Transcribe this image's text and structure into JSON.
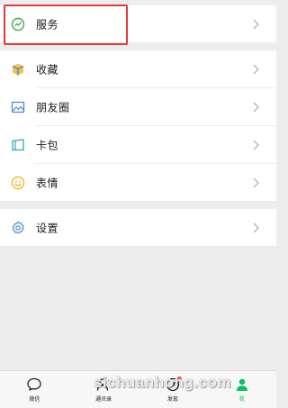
{
  "menu": {
    "service": {
      "label": "服务",
      "icon": "service-icon"
    },
    "items": [
      {
        "label": "收藏",
        "icon": "favorites-icon"
      },
      {
        "label": "朋友圈",
        "icon": "moments-icon"
      },
      {
        "label": "卡包",
        "icon": "card-icon"
      },
      {
        "label": "表情",
        "icon": "sticker-icon"
      }
    ],
    "settings": {
      "label": "设置",
      "icon": "settings-icon"
    }
  },
  "tabbar": {
    "tabs": [
      {
        "label": "微信",
        "icon": "chat-icon"
      },
      {
        "label": "通讯录",
        "icon": "contacts-icon"
      },
      {
        "label": "发现",
        "icon": "discover-icon"
      },
      {
        "label": "我",
        "icon": "me-icon"
      }
    ],
    "active": "我"
  },
  "watermark": {
    "text": "sichuanhong.com"
  },
  "colors": {
    "accent": "#07c160",
    "highlight_box": "#e03a3a",
    "badge": "#f15a4a",
    "background": "#ededed"
  }
}
